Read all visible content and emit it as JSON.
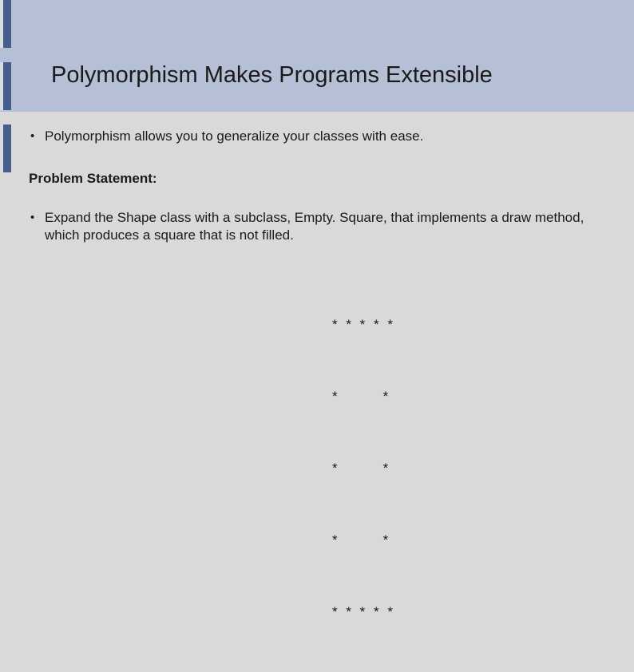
{
  "title": "Polymorphism Makes Programs Extensible",
  "bullets": {
    "b1": "Polymorphism allows you to generalize your classes with ease.",
    "b2": "Expand the Shape class with a subclass, Empty. Square, that implements a draw method, which produces a square that is not filled."
  },
  "section_label": "Problem Statement:",
  "ascii": {
    "l1": "* * * * *",
    "l2": "*       *",
    "l3": "*       *",
    "l4": "*       *",
    "l5": "* * * * *"
  }
}
